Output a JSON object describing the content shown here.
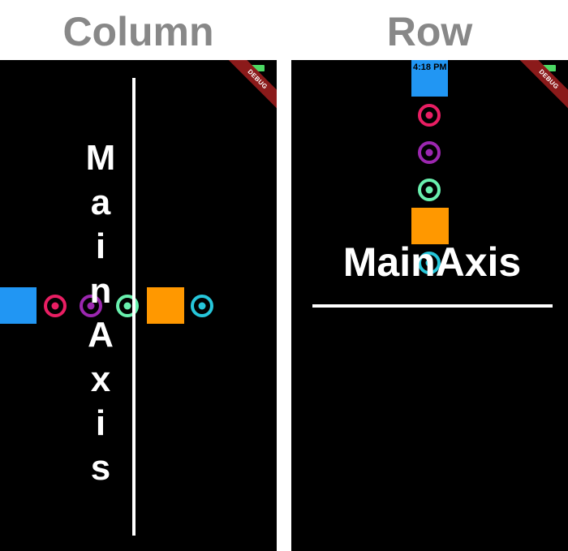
{
  "panels": {
    "column": {
      "heading": "Column",
      "axis_label_letters": [
        "M",
        "a",
        "i",
        "n",
        "A",
        "x",
        "i",
        "s"
      ],
      "debug_banner": "DEBUG"
    },
    "row": {
      "heading": "Row",
      "status_time": "4:18 PM",
      "axis_label": "MainAxis",
      "debug_banner": "DEBUG"
    }
  },
  "colors": {
    "blue": "#2196F3",
    "pink": "#E91E63",
    "purple": "#9C27B0",
    "green": "#69F0AE",
    "orange": "#FF9800",
    "cyan": "#26C6DA"
  }
}
